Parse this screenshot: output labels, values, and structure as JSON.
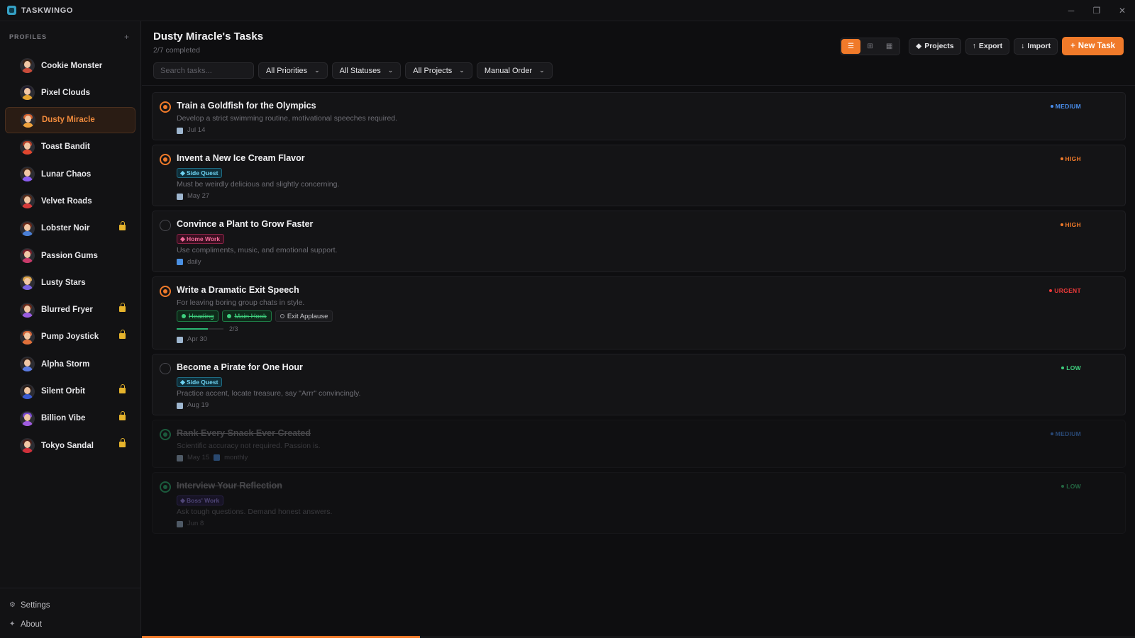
{
  "app": {
    "name": "TASKWINGO"
  },
  "window_controls": {
    "minimize": "─",
    "maximize": "❐",
    "close": "✕"
  },
  "sidebar": {
    "header": "PROFILES",
    "add_symbol": "+",
    "profiles": [
      {
        "name": "Cookie Monster",
        "locked": false,
        "active": false,
        "hair": "#3a2316",
        "shirt": "#c94b3a"
      },
      {
        "name": "Pixel Clouds",
        "locked": false,
        "active": false,
        "hair": "#1f1b2e",
        "shirt": "#e5a431"
      },
      {
        "name": "Dusty Miracle",
        "locked": false,
        "active": true,
        "hair": "#d3612f",
        "shirt": "#f0a23c"
      },
      {
        "name": "Toast Bandit",
        "locked": false,
        "active": false,
        "hair": "#b3412a",
        "shirt": "#e0462e"
      },
      {
        "name": "Lunar Chaos",
        "locked": false,
        "active": false,
        "hair": "#3e2518",
        "shirt": "#8a5cf0"
      },
      {
        "name": "Velvet Roads",
        "locked": false,
        "active": false,
        "hair": "#5a2d1b",
        "shirt": "#d63a3a"
      },
      {
        "name": "Lobster Noir",
        "locked": true,
        "active": false,
        "hair": "#6b2a1a",
        "shirt": "#4a7fd6"
      },
      {
        "name": "Passion Gums",
        "locked": false,
        "active": false,
        "hair": "#7a1f2a",
        "shirt": "#c93a6a"
      },
      {
        "name": "Lusty Stars",
        "locked": false,
        "active": false,
        "hair": "#d9a44a",
        "shirt": "#7a63e0"
      },
      {
        "name": "Blurred Fryer",
        "locked": true,
        "active": false,
        "hair": "#6a2a1a",
        "shirt": "#9a5ce0"
      },
      {
        "name": "Pump Joystick",
        "locked": true,
        "active": false,
        "hair": "#d0653a",
        "shirt": "#e0703a"
      },
      {
        "name": "Alpha Storm",
        "locked": false,
        "active": false,
        "hair": "#2e1f1a",
        "shirt": "#5a7ae0"
      },
      {
        "name": "Silent Orbit",
        "locked": true,
        "active": false,
        "hair": "#2a1d18",
        "shirt": "#3a5ad0"
      },
      {
        "name": "Billion Vibe",
        "locked": true,
        "active": false,
        "hair": "#7a4ad0",
        "shirt": "#a05ce0"
      },
      {
        "name": "Tokyo Sandal",
        "locked": true,
        "active": false,
        "hair": "#4a1f1a",
        "shirt": "#d0303a"
      }
    ],
    "footer": [
      {
        "label": "Settings",
        "icon": "gear-icon",
        "glyph": "⚙"
      },
      {
        "label": "About",
        "icon": "sparkle-icon",
        "glyph": "✦"
      }
    ]
  },
  "header": {
    "title": "Dusty Miracle's Tasks",
    "subtitle": "2/7 completed",
    "view_modes": [
      {
        "name": "list-view",
        "glyph": "☰",
        "active": true
      },
      {
        "name": "board-view",
        "glyph": "⊞",
        "active": false
      },
      {
        "name": "calendar-view",
        "glyph": "▦",
        "active": false
      }
    ],
    "buttons": {
      "projects": "Projects",
      "export": "Export",
      "import": "Import",
      "new_task": "New Task"
    }
  },
  "filters": {
    "search_placeholder": "Search tasks...",
    "priority": "All Priorities",
    "status": "All Statuses",
    "project": "All Projects",
    "order": "Manual Order"
  },
  "colors": {
    "accent": "#f07a2a",
    "medium": "#4a90f0",
    "high": "#f07a2a",
    "urgent": "#f03a3a",
    "low": "#3ed07e"
  },
  "tasks": [
    {
      "title": "Train a Goldfish for the Olympics",
      "status": "in-progress",
      "project": null,
      "description": "Develop a strict swimming routine, motivational speeches required.",
      "due": "Jul 14",
      "recurrence": null,
      "priority": "MEDIUM",
      "priority_color": "#4a90f0",
      "done": false
    },
    {
      "title": "Invent a New Ice Cream Flavor",
      "status": "in-progress",
      "project": {
        "label": "Side Quest",
        "style": "cyan"
      },
      "description": "Must be weirdly delicious and slightly concerning.",
      "due": "May 27",
      "recurrence": null,
      "priority": "HIGH",
      "priority_color": "#f07a2a",
      "done": false
    },
    {
      "title": "Convince a Plant to Grow Faster",
      "status": "todo",
      "project": {
        "label": "Home Work",
        "style": "pink"
      },
      "description": "Use compliments, music, and emotional support.",
      "due": null,
      "recurrence": "daily",
      "priority": "HIGH",
      "priority_color": "#f07a2a",
      "done": false
    },
    {
      "title": "Write a Dramatic Exit Speech",
      "status": "in-progress",
      "project": null,
      "description": "For leaving boring group chats in style.",
      "subtasks": [
        {
          "label": "Heading",
          "done": true
        },
        {
          "label": "Main Hook",
          "done": true
        },
        {
          "label": "Exit Applause",
          "done": false
        }
      ],
      "subtask_progress": "2/3",
      "subtask_fraction": 0.6667,
      "due": "Apr 30",
      "recurrence": null,
      "priority": "URGENT",
      "priority_color": "#f03a3a",
      "done": false
    },
    {
      "title": "Become a Pirate for One Hour",
      "status": "todo",
      "project": {
        "label": "Side Quest",
        "style": "cyan"
      },
      "description": "Practice accent, locate treasure, say \"Arrr\" convincingly.",
      "due": "Aug 19",
      "recurrence": null,
      "priority": "LOW",
      "priority_color": "#3ed07e",
      "done": false
    },
    {
      "title": "Rank Every Snack Ever Created",
      "status": "complete",
      "project": null,
      "description": "Scientific accuracy not required. Passion is.",
      "due": "May 15",
      "recurrence": "monthly",
      "priority": "MEDIUM",
      "priority_color": "#4a90f0",
      "done": true
    },
    {
      "title": "Interview Your Reflection",
      "status": "complete",
      "project": {
        "label": "Boss' Work",
        "style": "purple"
      },
      "description": "Ask tough questions. Demand honest answers.",
      "due": "Jun 8",
      "recurrence": null,
      "priority": "LOW",
      "priority_color": "#3ed07e",
      "done": true
    }
  ],
  "scroll_progress_fraction": 0.28
}
